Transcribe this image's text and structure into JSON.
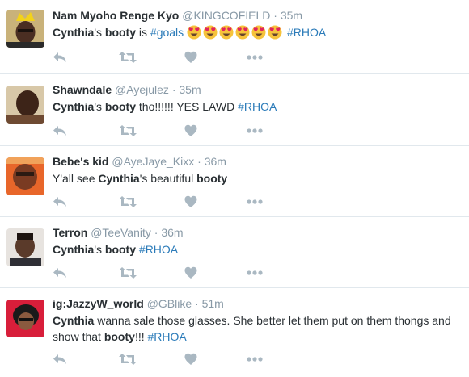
{
  "colors": {
    "name": "#292f33",
    "muted": "#8899a6",
    "link": "#2b7bb9",
    "icon": "#aab8c2",
    "divider": "#e1e8ed"
  },
  "icons": [
    "reply-icon",
    "retweet-icon",
    "like-icon",
    "more-icon",
    "heart-eyes-emoji"
  ],
  "tweets": [
    {
      "name": "Nam Myoho Renge Kyo",
      "handle": "@KINGCOFIELD",
      "sep": "·",
      "time": "35m",
      "t1": "Cynthia",
      "t2": "'s ",
      "t3": "booty",
      "t4": " is ",
      "t5": "#goals",
      "t6": " ",
      "t7": "#RHOA",
      "emoji_count": 6
    },
    {
      "name": "Shawndale",
      "handle": "@Ayejulez",
      "sep": "·",
      "time": "35m",
      "t1": "Cynthia",
      "t2": "'s ",
      "t3": "booty",
      "t4": " tho!!!!!! YES LAWD ",
      "t5": "#RHOA"
    },
    {
      "name": "Bebe's kid",
      "handle": "@AyeJaye_Kixx",
      "sep": "·",
      "time": "36m",
      "t1": "Y'all see ",
      "t2": "Cynthia",
      "t3": "'s beautiful ",
      "t4": "booty"
    },
    {
      "name": "Terron",
      "handle": "@TeeVanity",
      "sep": "·",
      "time": "36m",
      "t1": "Cynthia",
      "t2": "'s ",
      "t3": "booty",
      "t4": " ",
      "t5": "#RHOA"
    },
    {
      "name": "ig:JazzyW_world",
      "handle": "@GBlike",
      "sep": "·",
      "time": "51m",
      "t1": "Cynthia",
      "t2": " wanna sale those glasses. She better let them put on them thongs and",
      "t3": "show that ",
      "t4": "booty",
      "t5": "!!! ",
      "t6": "#RHOA"
    }
  ]
}
